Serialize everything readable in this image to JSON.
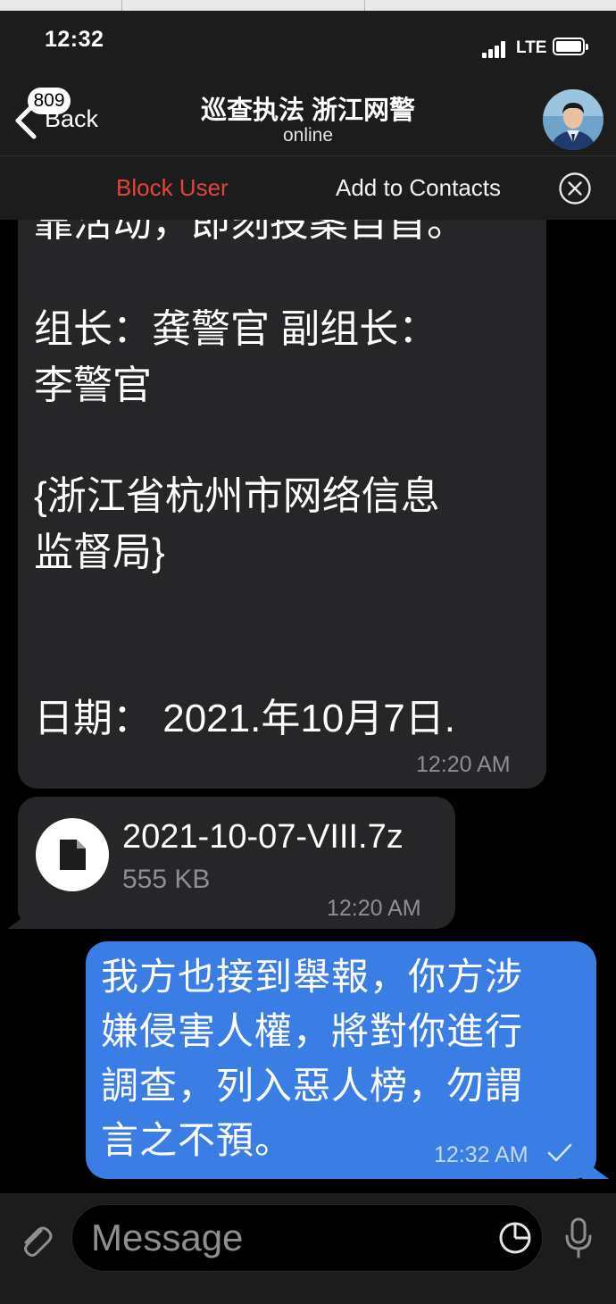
{
  "status_bar": {
    "time": "12:32",
    "network": "LTE"
  },
  "nav": {
    "back_label": "Back",
    "unread_badge": "809",
    "title": "巡查执法 浙江网警",
    "status": "online",
    "avatar_icon": "police-officer-avatar"
  },
  "action_bar": {
    "block_label": "Block User",
    "add_contacts_label": "Add to Contacts",
    "close_icon": "close-circle-icon"
  },
  "messages": {
    "incoming_text": {
      "lines": [
        "靠活动，即刻投案自首。",
        "组长：龚警官   副组长：",
        "李警官",
        "{浙江省杭州市网络信息",
        "监督局}",
        "日期：  2021.年10月7日."
      ],
      "time": "12:20 AM"
    },
    "incoming_file": {
      "file_name": "2021-10-07-VIII.7z",
      "file_size": "555 KB",
      "time": "12:20 AM",
      "icon": "document-icon"
    },
    "outgoing_text": {
      "lines": [
        "我方也接到舉報，你方涉",
        "嫌侵害人權，將對你進行",
        "調查，列入惡人榜，勿謂",
        "言之不預。"
      ],
      "time": "12:32 AM",
      "read_icon": "checkmark-icon"
    }
  },
  "input": {
    "placeholder": "Message",
    "attach_icon": "paperclip-icon",
    "sticker_icon": "sticker-icon",
    "mic_icon": "microphone-icon"
  },
  "colors": {
    "background": "#000000",
    "bar": "#1c1c1d",
    "incoming_bubble": "#262628",
    "outgoing_bubble": "#3a7de4",
    "block_red": "#e1453b"
  }
}
